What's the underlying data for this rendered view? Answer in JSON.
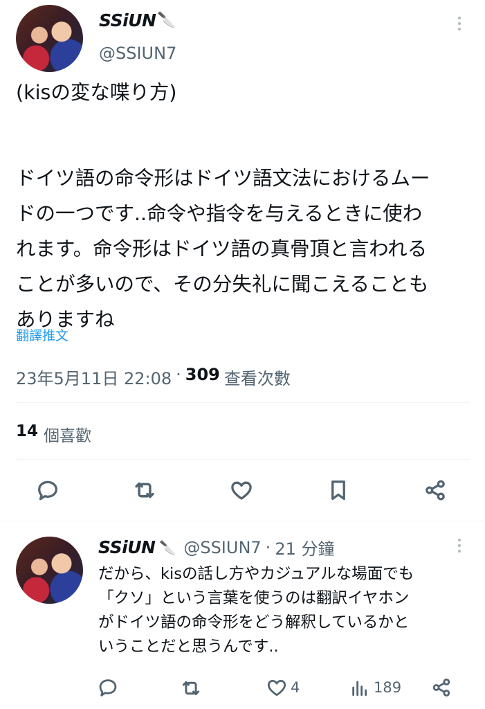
{
  "main_tweet": {
    "display_name": "SSiUN",
    "display_emoji": "🔪",
    "handle": "@SSIUN7",
    "text_lines": [
      "(kisの変な喋り方)",
      "",
      "ドイツ語の命令形はドイツ語文法におけるムー",
      "ドの一つです..命令や指令を与えるときに使わ",
      "れます。命令形はドイツ語の真骨頂と言われる",
      "ことが多いので、その分失礼に聞こえることも",
      "ありますね"
    ],
    "translate_label": "翻譯推文",
    "timestamp": "23年5月11日 22:08",
    "separator": "·",
    "view_count": "309",
    "view_label": "查看次數",
    "like_count": "14",
    "like_label": "個喜歡"
  },
  "reply_tweet": {
    "display_name": "SSiUN",
    "display_emoji": "🔪",
    "handle": "@SSIUN7",
    "separator": "·",
    "time": "21 分鐘",
    "text_lines": [
      "だから、kisの話し方やカジュアルな場面でも",
      "「クソ」という言葉を使うのは翻訳イヤホン",
      "がドイツ語の命令形をどう解釈しているかと",
      "いうことだと思うんです.."
    ],
    "like_count": "4",
    "view_count": "189"
  }
}
